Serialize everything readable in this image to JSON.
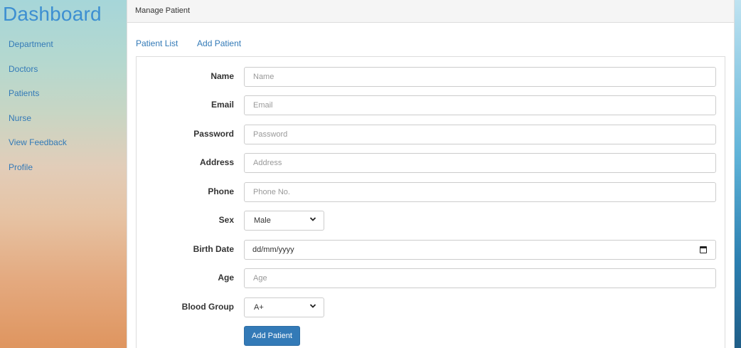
{
  "sidebar": {
    "brand": "Dashboard",
    "items": [
      {
        "label": "Department"
      },
      {
        "label": "Doctors"
      },
      {
        "label": "Patients"
      },
      {
        "label": "Nurse"
      },
      {
        "label": "View Feedback"
      },
      {
        "label": "Profile"
      }
    ]
  },
  "panel": {
    "heading": "Manage Patient",
    "tabs": [
      {
        "label": "Patient List"
      },
      {
        "label": "Add Patient"
      }
    ]
  },
  "form": {
    "name": {
      "label": "Name",
      "placeholder": "Name"
    },
    "email": {
      "label": "Email",
      "placeholder": "Email"
    },
    "password": {
      "label": "Password",
      "placeholder": "Password"
    },
    "address": {
      "label": "Address",
      "placeholder": "Address"
    },
    "phone": {
      "label": "Phone",
      "placeholder": "Phone No."
    },
    "sex": {
      "label": "Sex",
      "value": "Male"
    },
    "birth": {
      "label": "Birth Date",
      "value": "dd/mm/yyyy"
    },
    "age": {
      "label": "Age",
      "placeholder": "Age"
    },
    "blood": {
      "label": "Blood Group",
      "value": "A+"
    },
    "submit_label": "Add Patient"
  },
  "colors": {
    "accent": "#337ab7",
    "brand": "#3d8fd1"
  }
}
